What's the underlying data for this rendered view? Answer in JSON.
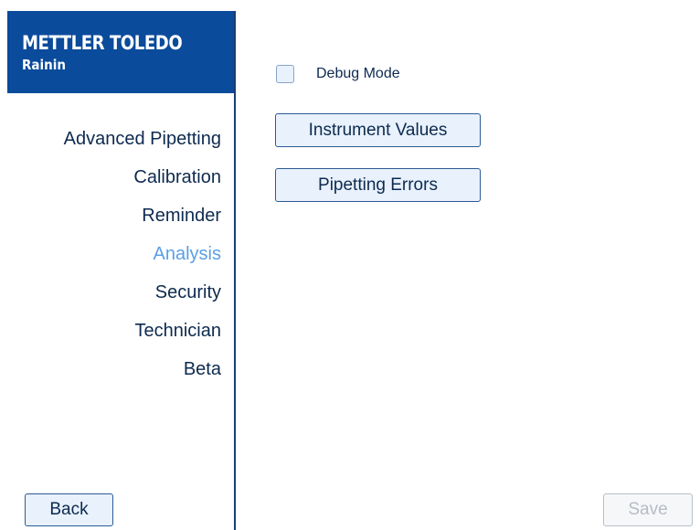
{
  "brand": {
    "logo_text": "METTLER TOLEDO",
    "sub_text": "Rainin",
    "color": "#0a4b9b"
  },
  "sidebar": {
    "items": [
      {
        "label": "Advanced Pipetting",
        "active": false
      },
      {
        "label": "Calibration",
        "active": false
      },
      {
        "label": "Reminder",
        "active": false
      },
      {
        "label": "Analysis",
        "active": true
      },
      {
        "label": "Security",
        "active": false
      },
      {
        "label": "Technician",
        "active": false
      },
      {
        "label": "Beta",
        "active": false
      }
    ],
    "active_color": "#5a9fe6",
    "back_label": "Back"
  },
  "main": {
    "debug_mode": {
      "label": "Debug Mode",
      "checked": false
    },
    "instrument_values_label": "Instrument Values",
    "pipetting_errors_label": "Pipetting Errors",
    "save_label": "Save",
    "save_enabled": false
  }
}
